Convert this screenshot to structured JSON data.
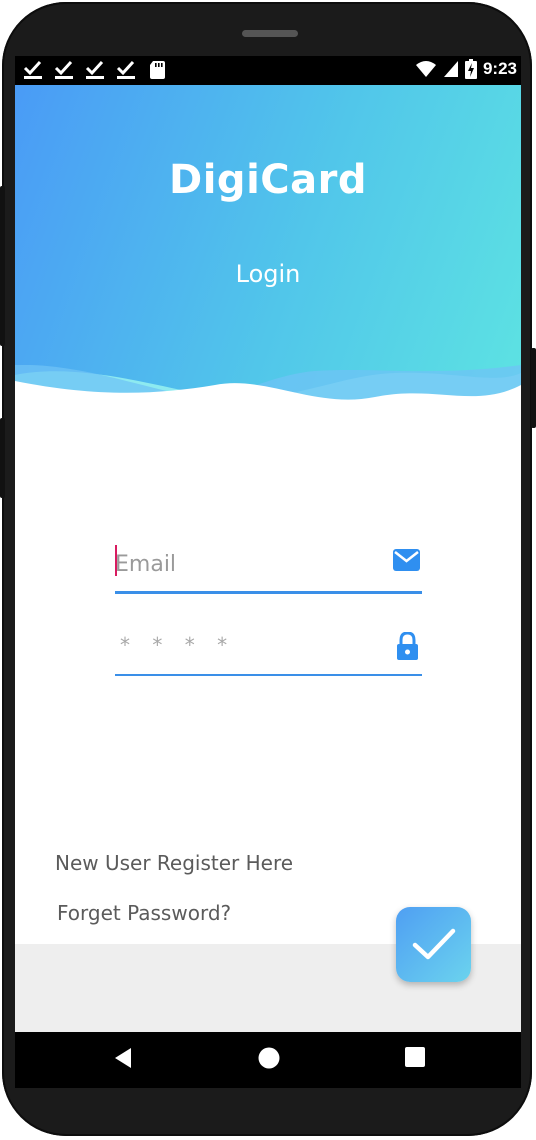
{
  "status_bar": {
    "time": "9:23",
    "icons": [
      "check-download-icon",
      "check-download-icon",
      "check-download-icon",
      "check-download-icon",
      "sd-card-icon",
      "wifi-icon",
      "cell-signal-icon",
      "battery-charging-icon"
    ]
  },
  "header": {
    "app_title": "DigiCard",
    "subtitle": "Login",
    "gradient": [
      "#4a9bf6",
      "#5de3e2"
    ]
  },
  "form": {
    "email": {
      "value": "",
      "placeholder": "Email",
      "icon": "mail-icon"
    },
    "password": {
      "value": "",
      "placeholder": "* * * *",
      "icon": "lock-icon"
    },
    "accent_color": "#3a8fe8"
  },
  "links": {
    "register": "New User Register Here",
    "forgot_password": "Forget Password?"
  },
  "submit": {
    "icon": "checkmark-icon"
  },
  "nav_bar": {
    "buttons": [
      "back-icon",
      "home-icon",
      "recents-icon"
    ]
  }
}
